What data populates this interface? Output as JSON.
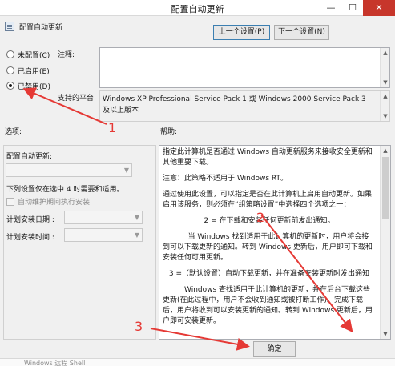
{
  "window": {
    "title": "配置自动更新",
    "controls": {
      "minimize": "—",
      "maximize": "☐",
      "close": "✕"
    }
  },
  "header": {
    "policy_name": "配置自动更新",
    "prev_button": "上一个设置(P)",
    "next_button": "下一个设置(N)"
  },
  "state": {
    "options": [
      {
        "label": "未配置(C)",
        "checked": false
      },
      {
        "label": "已启用(E)",
        "checked": false
      },
      {
        "label": "已禁用(D)",
        "checked": true
      }
    ]
  },
  "comment": {
    "label": "注释:",
    "value": ""
  },
  "platform": {
    "label": "支持的平台:",
    "value": "Windows XP Professional Service Pack 1 或 Windows 2000 Service Pack 3 及以上版本"
  },
  "options_pane": {
    "label": "选项:",
    "configure_label": "配置自动更新:",
    "note": "下列设置仅在选中 4 时需要和适用。",
    "maintenance_checkbox": "自动维护期间执行安装",
    "schedule_day_label": "计划安装日期 :",
    "schedule_time_label": "计划安装时间 :"
  },
  "help_pane": {
    "label": "帮助:",
    "paragraphs": [
      "指定此计算机是否通过 Windows 自动更新服务来接收安全更新和其他重要下载。",
      "注意：此策略不适用于 Windows RT。",
      "通过使用此设置，可以指定是否在此计算机上启用自动更新。如果启用该服务，则必须在“组策略设置”中选择四个选项之一：",
      "2 = 在下载和安装任何更新前发出通知。",
      "当 Windows 找到适用于此计算机的更新时，用户将会接到可以下载更新的通知。转到 Windows 更新后，用户即可下载和安装任何可用更新。",
      "3 =（默认设置）自动下载更新，并在准备安装更新时发出通知",
      "Windows 查找适用于此计算机的更新，并在后台下载这些更新(在此过程中，用户不会收到通知或被打断工作)。完成下载后，用户将收到可以安装更新的通知。转到 Windows 更新后，用户即可安装更新。"
    ]
  },
  "footer": {
    "ok_button": "确定"
  },
  "annotations": {
    "one": "1",
    "two": "2",
    "three": "3",
    "color": "#e53935"
  },
  "background_strip": "Windows 远程 Shell"
}
